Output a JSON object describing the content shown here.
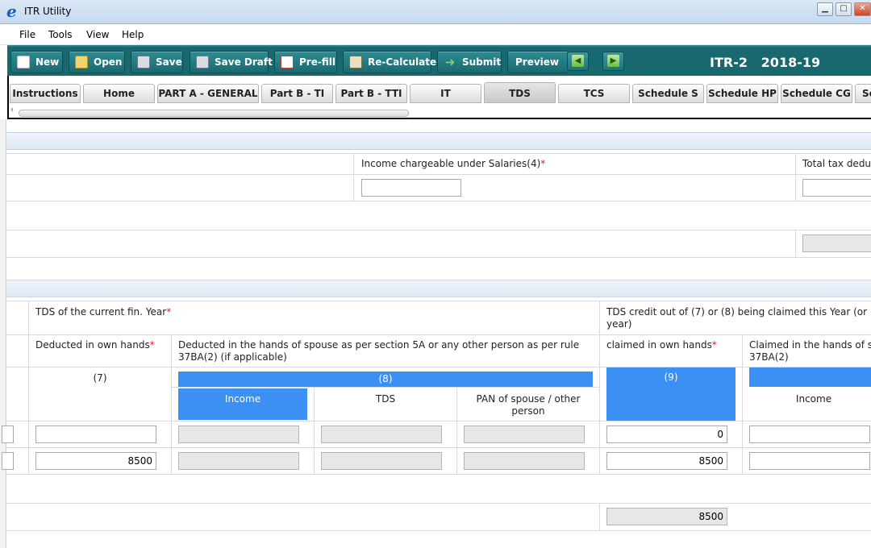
{
  "window": {
    "icon_letter": "e",
    "title": "ITR Utility",
    "minimize": "▁",
    "maximize": "□",
    "close": "✕"
  },
  "menu": [
    "File",
    "Tools",
    "View",
    "Help"
  ],
  "toolbar": {
    "buttons": {
      "new": "New",
      "open": "Open",
      "save": "Save",
      "save_draft": "Save Draft",
      "prefill": "Pre-fill",
      "recalculate": "Re-Calculate",
      "submit": "Submit",
      "preview": "Preview"
    },
    "back_icon": "arrow-left-icon",
    "forward_icon": "arrow-right-icon",
    "form_title": "ITR-2   2018-19"
  },
  "tabs": [
    "Instructions",
    "Home",
    "PART A - GENERAL",
    "Part B - TI",
    "Part B - TTI",
    "IT",
    "TDS",
    "TCS",
    "Schedule S",
    "Schedule HP",
    "Schedule CG",
    "Sc"
  ],
  "active_tab": "TDS",
  "salary_section": {
    "income_label": "Income chargeable under Salaries(4)",
    "total_tax_label": "Total tax dedu",
    "income_value": "",
    "total_tax_value": "",
    "total_value": ""
  },
  "tds_section": {
    "current_year_header": "TDS of the current fin. Year",
    "credit_header": "TDS credit out of (7) or (8) being claimed this Year (or year)",
    "credit_header_line1": "TDS credit out of (7) or (8) being claimed this Year (or",
    "credit_header_line2": "year)",
    "own_hands_label": "Deducted in own hands",
    "spouse_label": "Deducted in the hands of spouse as per section 5A or any other person as per rule 37BA(2) (if applicable)",
    "claimed_own_label": "claimed in own hands",
    "claimed_spouse_label": "Claimed in the hands of s 37BA(2)",
    "claimed_spouse_line1": "Claimed in the hands of s",
    "claimed_spouse_line2": "37BA(2)",
    "col7": "(7)",
    "col8": "(8)",
    "col9": "(9)",
    "sub_income": "Income",
    "sub_tds": "TDS",
    "sub_pan": "PAN of spouse / other person",
    "sub_income2": "Income",
    "rows": [
      {
        "own": "",
        "income": "",
        "tds": "",
        "pan": "",
        "claimed": "0",
        "claimed_income": ""
      },
      {
        "own": "8500",
        "income": "",
        "tds": "",
        "pan": "",
        "claimed": "8500",
        "claimed_income": ""
      }
    ],
    "total_claimed": "8500"
  },
  "colors": {
    "toolbar_bg": "#17686f",
    "highlight_blue": "#3d90f3",
    "required_red": "#e02020"
  }
}
